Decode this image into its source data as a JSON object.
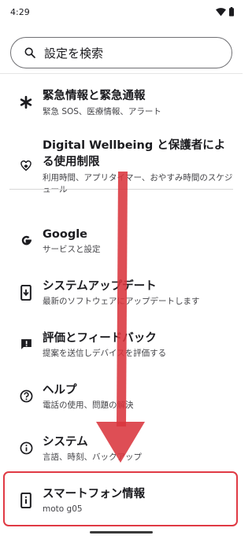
{
  "status": {
    "time": "4:29"
  },
  "search": {
    "placeholder": "設定を検索"
  },
  "items": [
    {
      "title": "緊急情報と緊急通報",
      "subtitle": "緊急 SOS、医療情報、アラート"
    },
    {
      "title": "Digital Wellbeing と保護者による使用制限",
      "subtitle": "利用時間、アプリタイマー、おやすみ時間のスケジュール"
    },
    {
      "title": "Google",
      "subtitle": "サービスと設定"
    },
    {
      "title": "システムアップデート",
      "subtitle": "最新のソフトウェアにアップデートします"
    },
    {
      "title": "評価とフィードバック",
      "subtitle": "提案を送信しデバイスを評価する"
    },
    {
      "title": "ヘルプ",
      "subtitle": "電話の使用、問題の解決"
    },
    {
      "title": "システム",
      "subtitle": "言語、時刻、バックアップ"
    },
    {
      "title": "スマートフォン情報",
      "subtitle": "moto g05"
    }
  ],
  "colors": {
    "highlight": "#e03a44",
    "arrow": "#d9363e"
  }
}
